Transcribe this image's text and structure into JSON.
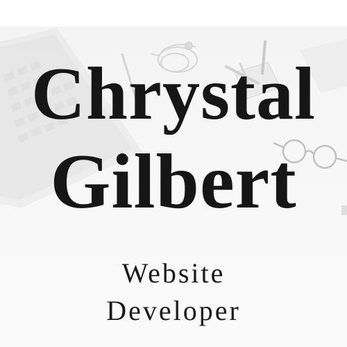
{
  "title": {
    "first_name": "Chrystal",
    "last_name": "Gilbert"
  },
  "subtitle": {
    "line1": "Website",
    "line2": "Developer"
  },
  "background": {
    "color": "#ffffff",
    "photo_tint": "#f5f5f5",
    "objects": [
      "laptop",
      "earphones",
      "pen-holder",
      "eyeglasses",
      "pen"
    ]
  },
  "text_color": "#161616"
}
